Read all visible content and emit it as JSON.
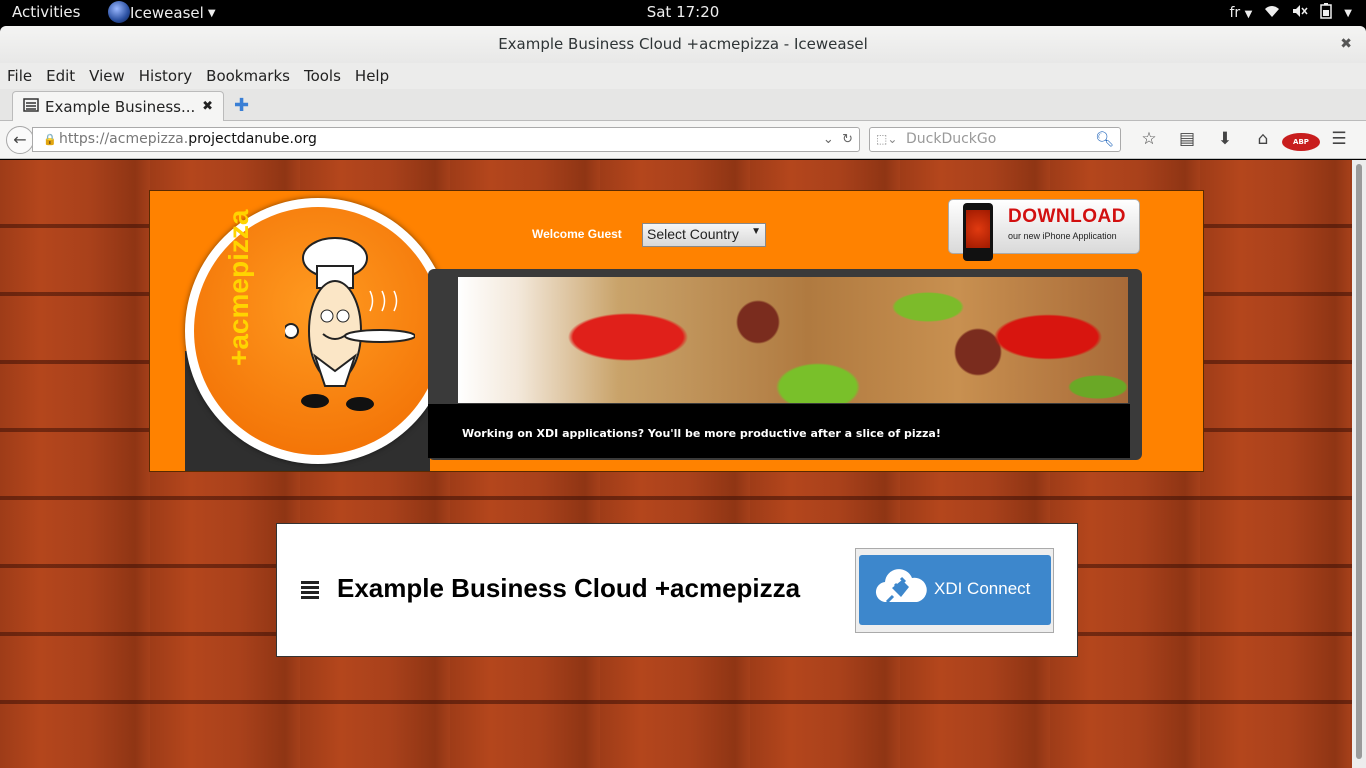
{
  "system_bar": {
    "activities": "Activities",
    "app_name": "Iceweasel",
    "clock": "Sat 17:20",
    "keyboard_layout": "fr"
  },
  "window": {
    "title": "Example Business Cloud +acmepizza - Iceweasel"
  },
  "menu": {
    "items": [
      "File",
      "Edit",
      "View",
      "History",
      "Bookmarks",
      "Tools",
      "Help"
    ]
  },
  "tabs": [
    {
      "label": "Example Business...",
      "active": true
    }
  ],
  "navigation": {
    "url_scheme_prefix": "https://acmepizza.",
    "url_host": "projectdanube.org",
    "search_placeholder": "DuckDuckGo",
    "abp_label": "ABP"
  },
  "banner": {
    "logo_text": "+acmepizza",
    "welcome": "Welcome Guest",
    "country_select": "Select Country",
    "download_title": "DOWNLOAD",
    "download_subtitle": "our new iPhone Application",
    "caption": "Working on XDI applications? You'll be more productive after a slice of pizza!"
  },
  "card": {
    "title": "Example Business Cloud +acmepizza",
    "button_label": "XDI Connect"
  },
  "colors": {
    "banner_orange": "#ff8200",
    "xdi_blue": "#3d87cc",
    "download_red": "#d21010",
    "logo_yellow": "#ffd400"
  }
}
